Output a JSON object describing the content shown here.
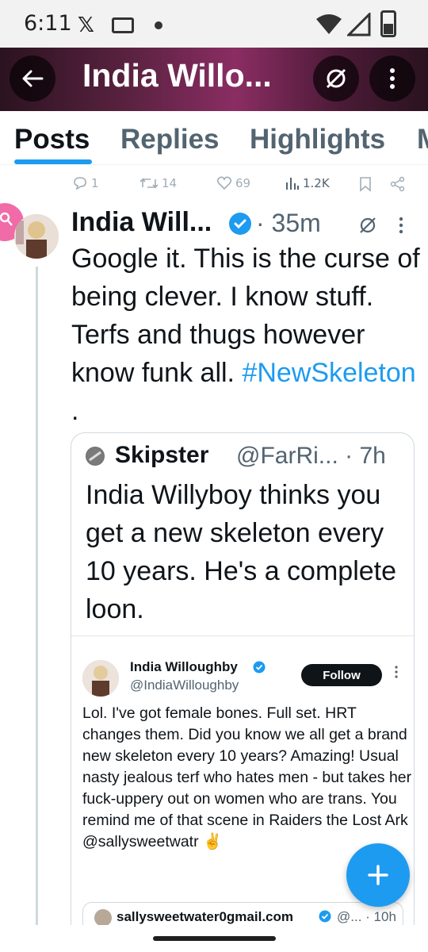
{
  "status_bar": {
    "time": "6:11",
    "icons": [
      "x-logo-icon",
      "mail-icon",
      "dot-icon",
      "wifi-icon",
      "cell-signal-icon",
      "battery-icon"
    ]
  },
  "header": {
    "title": "India Willo..."
  },
  "tabs": [
    "Posts",
    "Replies",
    "Highlights",
    "M"
  ],
  "top_actions": {
    "replies": "1",
    "reposts": "14",
    "likes": "69",
    "views": "1.2K"
  },
  "post": {
    "author": "India Will...",
    "time": "· 35m",
    "text": "Google it. This is the curse of being clever. I know stuff. Terfs and thugs however know funk all.",
    "hashtag": "#NewSkeleton",
    "after_hashtag": " ."
  },
  "quote": {
    "name": "Skipster",
    "handle": "@FarRi... · 7h",
    "text": "India Willyboy thinks you get a new skeleton every 10 years. He's a complete loon."
  },
  "inner_post": {
    "name": "India Willoughby",
    "handle": "@IndiaWilloughby",
    "follow": "Follow",
    "text": "Lol. I've got female bones. Full set. HRT changes them. Did you know we all get a brand new skeleton every 10 years? Amazing! Usual nasty jealous terf who hates men - but takes her fuck-uppery out on women who are trans. You remind me of that scene in Raiders the Lost Ark @sallysweetwatr ✌️"
  },
  "nested_quote": {
    "name": "sallysweetwater0gmail.com",
    "meta": "@... · 10h"
  },
  "colors": {
    "accent": "#1d9bf0",
    "text": "#0f1419",
    "muted": "#536471"
  }
}
